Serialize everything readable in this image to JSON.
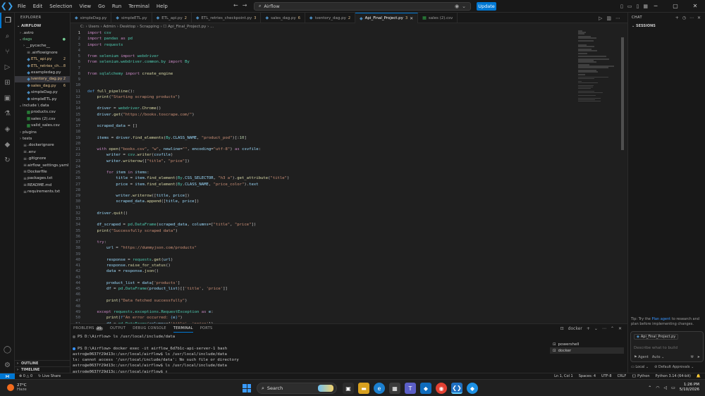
{
  "window": {
    "search_text": "Airflow",
    "update_label": "Update",
    "menu": [
      "File",
      "Edit",
      "Selection",
      "View",
      "Go",
      "Run",
      "Terminal",
      "Help"
    ]
  },
  "explorer": {
    "header": "EXPLORER",
    "root": "AIRFLOW",
    "items": [
      {
        "name": ".astro",
        "type": "folder",
        "indent": 1,
        "chev": ">"
      },
      {
        "name": "dags",
        "type": "folder",
        "indent": 1,
        "chev": "v",
        "badge": "●",
        "status": "mod"
      },
      {
        "name": "__pycache__",
        "type": "folder",
        "indent": 2,
        "chev": ">"
      },
      {
        "name": ".airflowignore",
        "type": "dot",
        "indent": 2
      },
      {
        "name": "ETL_api.py",
        "type": "py",
        "indent": 2,
        "badge": "2",
        "status": "err"
      },
      {
        "name": "ETL_retries_chec...",
        "type": "py",
        "indent": 2,
        "badge": "8",
        "status": "err"
      },
      {
        "name": "exampledag.py",
        "type": "py",
        "indent": 2
      },
      {
        "name": "iventory_dag.py",
        "type": "py",
        "indent": 2,
        "badge": "2",
        "status": "err",
        "selected": true
      },
      {
        "name": "sales_dag.py",
        "type": "py",
        "indent": 2,
        "badge": "6",
        "status": "err"
      },
      {
        "name": "simpleDag.py",
        "type": "py",
        "indent": 2
      },
      {
        "name": "simpleETL.py",
        "type": "py",
        "indent": 2
      },
      {
        "name": "include \\ data",
        "type": "folder",
        "indent": 1,
        "chev": "v"
      },
      {
        "name": "products.csv",
        "type": "csv",
        "indent": 2
      },
      {
        "name": "sales (2).csv",
        "type": "csv",
        "indent": 2
      },
      {
        "name": "valid_sales.csv",
        "type": "csv",
        "indent": 2
      },
      {
        "name": "plugins",
        "type": "folder",
        "indent": 1,
        "chev": ">"
      },
      {
        "name": "tests",
        "type": "folder",
        "indent": 1,
        "chev": ">"
      },
      {
        "name": ".dockerignore",
        "type": "dot",
        "indent": 1
      },
      {
        "name": ".env",
        "type": "dot",
        "indent": 1
      },
      {
        "name": ".gitignore",
        "type": "dot",
        "indent": 1
      },
      {
        "name": "airflow_settings.yaml",
        "type": "dot",
        "indent": 1
      },
      {
        "name": "Dockerfile",
        "type": "dot",
        "indent": 1
      },
      {
        "name": "packages.txt",
        "type": "dot",
        "indent": 1
      },
      {
        "name": "README.md",
        "type": "dot",
        "indent": 1
      },
      {
        "name": "requirements.txt",
        "type": "dot",
        "indent": 1
      }
    ],
    "outline": "OUTLINE",
    "timeline": "TIMELINE"
  },
  "tabs": [
    {
      "label": "simpleDag.py",
      "count": ""
    },
    {
      "label": "simpleETL.py",
      "count": ""
    },
    {
      "label": "ETL_api.py",
      "count": "2"
    },
    {
      "label": "ETL_retries_checkpoint.py",
      "count": "3"
    },
    {
      "label": "sales_dag.py",
      "count": "6"
    },
    {
      "label": "iventory_dag.py",
      "count": "2"
    },
    {
      "label": "Api_Final_Project.py",
      "count": "3",
      "active": true
    },
    {
      "label": "sales (2).csv",
      "count": ""
    }
  ],
  "breadcrumb": "C: › Users › Admin › Desktop › Scrapping › ☐ Api_Final_Project.py › ...",
  "code": [
    [
      [
        "k1",
        "import"
      ],
      [
        "t",
        " "
      ],
      [
        "cl",
        "csv"
      ]
    ],
    [
      [
        "k1",
        "import"
      ],
      [
        "t",
        " "
      ],
      [
        "cl",
        "pandas"
      ],
      [
        "t",
        " "
      ],
      [
        "k1",
        "as"
      ],
      [
        "t",
        " "
      ],
      [
        "cl",
        "pd"
      ]
    ],
    [
      [
        "k1",
        "import"
      ],
      [
        "t",
        " "
      ],
      [
        "cl",
        "requests"
      ]
    ],
    [],
    [
      [
        "k1",
        "from"
      ],
      [
        "t",
        " "
      ],
      [
        "cl",
        "selenium"
      ],
      [
        "t",
        " "
      ],
      [
        "k1",
        "import"
      ],
      [
        "t",
        " "
      ],
      [
        "cl",
        "webdriver"
      ]
    ],
    [
      [
        "k1",
        "from"
      ],
      [
        "t",
        " "
      ],
      [
        "cl",
        "selenium.webdriver.common.by"
      ],
      [
        "t",
        " "
      ],
      [
        "k1",
        "import"
      ],
      [
        "t",
        " "
      ],
      [
        "cl",
        "By"
      ]
    ],
    [],
    [
      [
        "k1",
        "from"
      ],
      [
        "t",
        " "
      ],
      [
        "cl",
        "sqlalchemy"
      ],
      [
        "t",
        " "
      ],
      [
        "k1",
        "import"
      ],
      [
        "t",
        " "
      ],
      [
        "fn",
        "create_engine"
      ]
    ],
    [],
    [],
    [
      [
        "k2",
        "def"
      ],
      [
        "t",
        " "
      ],
      [
        "fn",
        "full_pipeline"
      ],
      [
        "t",
        "():"
      ]
    ],
    [
      [
        "t",
        "    "
      ],
      [
        "fn",
        "print"
      ],
      [
        "t",
        "("
      ],
      [
        "st",
        "\"Starting scraping products\""
      ],
      [
        "t",
        ")"
      ]
    ],
    [],
    [
      [
        "t",
        "    "
      ],
      [
        "vr",
        "driver"
      ],
      [
        "t",
        " = "
      ],
      [
        "cl",
        "webdriver"
      ],
      [
        "t",
        "."
      ],
      [
        "fn",
        "Chrome"
      ],
      [
        "t",
        "()"
      ]
    ],
    [
      [
        "t",
        "    "
      ],
      [
        "vr",
        "driver"
      ],
      [
        "t",
        "."
      ],
      [
        "fn",
        "get"
      ],
      [
        "t",
        "("
      ],
      [
        "st",
        "\"https://books.toscrape.com/\""
      ],
      [
        "t",
        ")"
      ]
    ],
    [],
    [
      [
        "t",
        "    "
      ],
      [
        "vr",
        "scraped_data"
      ],
      [
        "t",
        " = []"
      ]
    ],
    [],
    [
      [
        "t",
        "    "
      ],
      [
        "vr",
        "items"
      ],
      [
        "t",
        " = "
      ],
      [
        "vr",
        "driver"
      ],
      [
        "t",
        "."
      ],
      [
        "fn",
        "find_elements"
      ],
      [
        "t",
        "("
      ],
      [
        "cl",
        "By"
      ],
      [
        "t",
        "."
      ],
      [
        "vr",
        "CLASS_NAME"
      ],
      [
        "t",
        ", "
      ],
      [
        "st",
        "\"product_pod\""
      ],
      [
        "t",
        ")[:"
      ],
      [
        "nm",
        "10"
      ],
      [
        "t",
        "]"
      ]
    ],
    [],
    [
      [
        "t",
        "    "
      ],
      [
        "k1",
        "with"
      ],
      [
        "t",
        " "
      ],
      [
        "fn",
        "open"
      ],
      [
        "t",
        "("
      ],
      [
        "st",
        "\"books.csv\""
      ],
      [
        "t",
        ", "
      ],
      [
        "st",
        "\"w\""
      ],
      [
        "t",
        ", "
      ],
      [
        "vr",
        "newline"
      ],
      [
        "t",
        "="
      ],
      [
        "st",
        "\"\""
      ],
      [
        "t",
        ", "
      ],
      [
        "vr",
        "encoding"
      ],
      [
        "t",
        "="
      ],
      [
        "st",
        "\"utf-8\""
      ],
      [
        "t",
        ") "
      ],
      [
        "k1",
        "as"
      ],
      [
        "t",
        " "
      ],
      [
        "vr",
        "csvfile"
      ],
      [
        "t",
        ":"
      ]
    ],
    [
      [
        "t",
        "        "
      ],
      [
        "vr",
        "writer"
      ],
      [
        "t",
        " = "
      ],
      [
        "cl",
        "csv"
      ],
      [
        "t",
        "."
      ],
      [
        "fn",
        "writer"
      ],
      [
        "t",
        "("
      ],
      [
        "vr",
        "csvfile"
      ],
      [
        "t",
        ")"
      ]
    ],
    [
      [
        "t",
        "        "
      ],
      [
        "vr",
        "writer"
      ],
      [
        "t",
        "."
      ],
      [
        "fn",
        "writerow"
      ],
      [
        "t",
        "(["
      ],
      [
        "st",
        "\"title\""
      ],
      [
        "t",
        ", "
      ],
      [
        "st",
        "\"price\""
      ],
      [
        "t",
        "])"
      ]
    ],
    [],
    [
      [
        "t",
        "        "
      ],
      [
        "k1",
        "for"
      ],
      [
        "t",
        " "
      ],
      [
        "vr",
        "item"
      ],
      [
        "t",
        " "
      ],
      [
        "k1",
        "in"
      ],
      [
        "t",
        " "
      ],
      [
        "vr",
        "items"
      ],
      [
        "t",
        ":"
      ]
    ],
    [
      [
        "t",
        "            "
      ],
      [
        "vr",
        "title"
      ],
      [
        "t",
        " = "
      ],
      [
        "vr",
        "item"
      ],
      [
        "t",
        "."
      ],
      [
        "fn",
        "find_element"
      ],
      [
        "t",
        "("
      ],
      [
        "cl",
        "By"
      ],
      [
        "t",
        "."
      ],
      [
        "vr",
        "CSS_SELECTOR"
      ],
      [
        "t",
        ", "
      ],
      [
        "st",
        "\"h3 a\""
      ],
      [
        "t",
        ")."
      ],
      [
        "fn",
        "get_attribute"
      ],
      [
        "t",
        "("
      ],
      [
        "st",
        "\"title\""
      ],
      [
        "t",
        ")"
      ]
    ],
    [
      [
        "t",
        "            "
      ],
      [
        "vr",
        "price"
      ],
      [
        "t",
        " = "
      ],
      [
        "vr",
        "item"
      ],
      [
        "t",
        "."
      ],
      [
        "fn",
        "find_element"
      ],
      [
        "t",
        "("
      ],
      [
        "cl",
        "By"
      ],
      [
        "t",
        "."
      ],
      [
        "vr",
        "CLASS_NAME"
      ],
      [
        "t",
        ", "
      ],
      [
        "st",
        "\"price_color\""
      ],
      [
        "t",
        ")."
      ],
      [
        "vr",
        "text"
      ]
    ],
    [],
    [
      [
        "t",
        "            "
      ],
      [
        "vr",
        "writer"
      ],
      [
        "t",
        "."
      ],
      [
        "fn",
        "writerow"
      ],
      [
        "t",
        "(["
      ],
      [
        "vr",
        "title"
      ],
      [
        "t",
        ", "
      ],
      [
        "vr",
        "price"
      ],
      [
        "t",
        "])"
      ]
    ],
    [
      [
        "t",
        "            "
      ],
      [
        "vr",
        "scraped_data"
      ],
      [
        "t",
        "."
      ],
      [
        "fn",
        "append"
      ],
      [
        "t",
        "(["
      ],
      [
        "vr",
        "title"
      ],
      [
        "t",
        ", "
      ],
      [
        "vr",
        "price"
      ],
      [
        "t",
        "])"
      ]
    ],
    [],
    [
      [
        "t",
        "    "
      ],
      [
        "vr",
        "driver"
      ],
      [
        "t",
        "."
      ],
      [
        "fn",
        "quit"
      ],
      [
        "t",
        "()"
      ]
    ],
    [],
    [
      [
        "t",
        "    "
      ],
      [
        "vr",
        "df_scraped"
      ],
      [
        "t",
        " = "
      ],
      [
        "cl",
        "pd"
      ],
      [
        "t",
        "."
      ],
      [
        "cl",
        "DataFrame"
      ],
      [
        "t",
        "("
      ],
      [
        "vr",
        "scraped_data"
      ],
      [
        "t",
        ", "
      ],
      [
        "vr",
        "columns"
      ],
      [
        "t",
        "=["
      ],
      [
        "st",
        "\"title\""
      ],
      [
        "t",
        ", "
      ],
      [
        "st",
        "\"price\""
      ],
      [
        "t",
        "])"
      ]
    ],
    [
      [
        "t",
        "    "
      ],
      [
        "fn",
        "print"
      ],
      [
        "t",
        "("
      ],
      [
        "st",
        "\"Successfully scraped data\""
      ],
      [
        "t",
        ")"
      ]
    ],
    [],
    [
      [
        "t",
        "    "
      ],
      [
        "k1",
        "try"
      ],
      [
        "t",
        ":"
      ]
    ],
    [
      [
        "t",
        "        "
      ],
      [
        "vr",
        "url"
      ],
      [
        "t",
        " = "
      ],
      [
        "st",
        "\"https://dummyjson.com/products\""
      ]
    ],
    [],
    [
      [
        "t",
        "        "
      ],
      [
        "vr",
        "response"
      ],
      [
        "t",
        " = "
      ],
      [
        "cl",
        "requests"
      ],
      [
        "t",
        "."
      ],
      [
        "fn",
        "get"
      ],
      [
        "t",
        "("
      ],
      [
        "vr",
        "url"
      ],
      [
        "t",
        ")"
      ]
    ],
    [
      [
        "t",
        "        "
      ],
      [
        "vr",
        "response"
      ],
      [
        "t",
        "."
      ],
      [
        "fn",
        "raise_for_status"
      ],
      [
        "t",
        "()"
      ]
    ],
    [
      [
        "t",
        "        "
      ],
      [
        "vr",
        "data"
      ],
      [
        "t",
        " = "
      ],
      [
        "vr",
        "response"
      ],
      [
        "t",
        "."
      ],
      [
        "fn",
        "json"
      ],
      [
        "t",
        "()"
      ]
    ],
    [],
    [
      [
        "t",
        "        "
      ],
      [
        "vr",
        "product_list"
      ],
      [
        "t",
        " = "
      ],
      [
        "vr",
        "data"
      ],
      [
        "t",
        "["
      ],
      [
        "st",
        "'products'"
      ],
      [
        "t",
        "]"
      ]
    ],
    [
      [
        "t",
        "        "
      ],
      [
        "vr",
        "df"
      ],
      [
        "t",
        " = "
      ],
      [
        "cl",
        "pd"
      ],
      [
        "t",
        "."
      ],
      [
        "cl",
        "DataFrame"
      ],
      [
        "t",
        "("
      ],
      [
        "vr",
        "product_list"
      ],
      [
        "t",
        ")[["
      ],
      [
        "st",
        "'title'"
      ],
      [
        "t",
        ", "
      ],
      [
        "st",
        "'price'"
      ],
      [
        "t",
        "]]"
      ]
    ],
    [],
    [
      [
        "t",
        "        "
      ],
      [
        "fn",
        "print"
      ],
      [
        "t",
        "("
      ],
      [
        "st",
        "\"Data fetched successfully\""
      ],
      [
        "t",
        ")"
      ]
    ],
    [],
    [
      [
        "t",
        "    "
      ],
      [
        "k1",
        "except"
      ],
      [
        "t",
        " "
      ],
      [
        "cl",
        "requests"
      ],
      [
        "t",
        "."
      ],
      [
        "cl",
        "exceptions"
      ],
      [
        "t",
        "."
      ],
      [
        "cl",
        "RequestException"
      ],
      [
        "t",
        " "
      ],
      [
        "k1",
        "as"
      ],
      [
        "t",
        " "
      ],
      [
        "vr",
        "e"
      ],
      [
        "t",
        ":"
      ]
    ],
    [
      [
        "t",
        "        "
      ],
      [
        "fn",
        "print"
      ],
      [
        "t",
        "("
      ],
      [
        "k2",
        "f"
      ],
      [
        "st",
        "\"An error occurred: "
      ],
      [
        "k2",
        "{"
      ],
      [
        "vr",
        "e"
      ],
      [
        "k2",
        "}"
      ],
      [
        "st",
        "\""
      ],
      [
        "t",
        ")"
      ]
    ],
    [
      [
        "t",
        "        "
      ],
      [
        "vr",
        "df"
      ],
      [
        "t",
        " = "
      ],
      [
        "cl",
        "pd"
      ],
      [
        "t",
        "."
      ],
      [
        "cl",
        "DataFrame"
      ],
      [
        "t",
        "("
      ],
      [
        "vr",
        "columns"
      ],
      [
        "t",
        "=["
      ],
      [
        "st",
        "'title'"
      ],
      [
        "t",
        ", "
      ],
      [
        "st",
        "'price'"
      ],
      [
        "t",
        "])"
      ]
    ]
  ],
  "panel": {
    "tabs": [
      {
        "label": "PROBLEMS",
        "badge": "25"
      },
      {
        "label": "OUTPUT",
        "badge": ""
      },
      {
        "label": "DEBUG CONSOLE",
        "badge": ""
      },
      {
        "label": "TERMINAL",
        "badge": "",
        "active": true
      },
      {
        "label": "PORTS",
        "badge": ""
      }
    ],
    "terminal_lines": [
      {
        "text": "PS D:\\Airflow> ls /usr/local/include/data",
        "mark": "grey"
      },
      {
        "text": "",
        "mark": ""
      },
      {
        "text": "PS D:\\Airflow> docker exec -it airflow_6d7b1c-api-server-1 bash",
        "mark": "blue"
      },
      {
        "text": "astro@e0637f29d13c:/usr/local/airflow$ ls /usr/local/include/data",
        "mark": ""
      },
      {
        "text": "ls: cannot access '/usr/local/include/data': No such file or directory",
        "mark": ""
      },
      {
        "text": "astro@e0637f29d13c:/usr/local/airflow$ ls /usr/local/include/data",
        "mark": ""
      },
      {
        "text": "astro@e0637f29d13c:/usr/local/airflow$ ▯",
        "mark": ""
      }
    ],
    "terminal_name": "docker",
    "term_list": [
      {
        "label": "powershell",
        "sel": false
      },
      {
        "label": "docker",
        "sel": true
      }
    ]
  },
  "chat": {
    "header": "CHAT",
    "sessions": "SESSIONS",
    "tip_prefix": "Tip: Try the ",
    "tip_link": "Plan agent",
    "tip_suffix": " to research and plan before implementing changes.",
    "file_chip": "Api_Final_Project.py",
    "placeholder": "Describe what to build",
    "agent": "Agent",
    "model": "Auto",
    "foot_local": "Local",
    "foot_approval": "Default Approvals"
  },
  "status": {
    "errors": "⊗ 0 △ 0",
    "live_share": "Live Share",
    "position": "Ln 1, Col 1",
    "spaces": "Spaces: 4",
    "encoding": "UTF-8",
    "eol": "CRLF",
    "language": "{} Python",
    "interpreter": "Python 3.14 (64-bit)"
  },
  "taskbar": {
    "temp": "27°C",
    "weather_sub": "Haze",
    "search_label": "Search",
    "time": "1:26 PM",
    "date": "5/10/2026"
  }
}
